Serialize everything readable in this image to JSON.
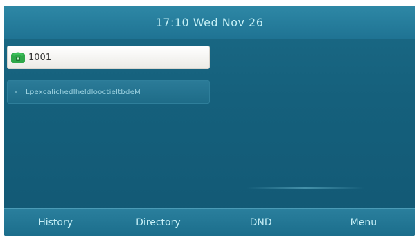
{
  "status_bar": {
    "datetime": "17:10 Wed Nov 26"
  },
  "lines": [
    {
      "label": "1001",
      "state": "registered",
      "icon": "phone-icon"
    },
    {
      "label": "LpexcalichedlheldlooctieltbdeM",
      "state": "unregistered"
    }
  ],
  "softkeys": [
    {
      "label": "History"
    },
    {
      "label": "Directory"
    },
    {
      "label": "DND"
    },
    {
      "label": "Menu"
    }
  ],
  "colors": {
    "screen_bg": "#15607c",
    "status_bar": "#2e88a6",
    "active_line_bg": "#ffffff",
    "phone_icon": "#2fa84a",
    "softkey_text": "#c5eef6"
  }
}
